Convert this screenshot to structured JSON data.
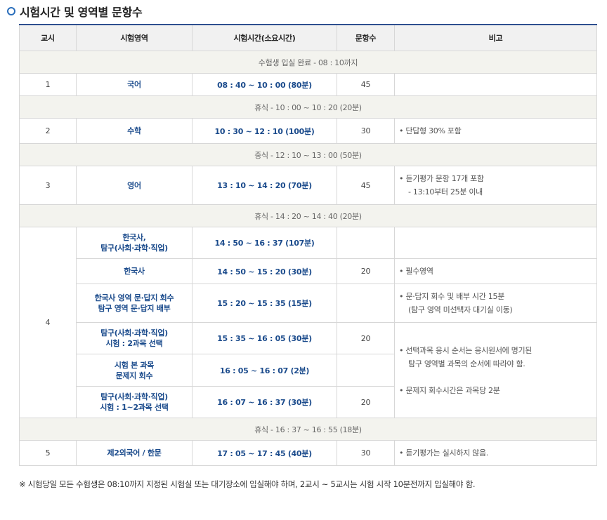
{
  "title": "시험시간 및 영역별 문항수",
  "headers": [
    "교시",
    "시험영역",
    "시험시간(소요시간)",
    "문항수",
    "비고"
  ],
  "rows": {
    "entry": "수험생 입실 완료 - 08 : 10까지",
    "p1": {
      "period": "1",
      "subject": "국어",
      "time": "08 : 40 ~ 10 : 00 (80분)",
      "count": "45",
      "note": ""
    },
    "break1": "휴식 - 10 : 00 ~ 10 : 20 (20분)",
    "p2": {
      "period": "2",
      "subject": "수학",
      "time": "10 : 30 ~ 12 : 10 (100분)",
      "count": "30",
      "note": "• 단답형 30% 포함"
    },
    "lunch": "중식 - 12 : 10 ~ 13 : 00 (50분)",
    "p3": {
      "period": "3",
      "subject": "영어",
      "time": "13 : 10 ~ 14 : 20 (70분)",
      "count": "45",
      "note1": "• 듣기평가 문항 17개 포함",
      "note2": "- 13:10부터 25분 이내"
    },
    "break2": "휴식 - 14 : 20 ~ 14 : 40 (20분)",
    "p4": {
      "period": "4",
      "r1": {
        "subject1": "한국사,",
        "subject2": "탐구(사회·과학·직업)",
        "time": "14 : 50 ~ 16 : 37 (107분)"
      },
      "r2": {
        "subject": "한국사",
        "time": "14 : 50 ~ 15 : 20 (30분)",
        "count": "20",
        "note": "• 필수영역"
      },
      "r3": {
        "subject1": "한국사 영역 문·답지 회수",
        "subject2": "탐구 영역 문·답지 배부",
        "time": "15 : 20 ~ 15 : 35 (15분)",
        "note1": "• 문·답지 회수 및 배부 시간 15분",
        "note2": "(탐구 영역 미선택자 대기실 이동)"
      },
      "r4": {
        "subject1": "탐구(사회·과학·직업)",
        "subject2": "시험 : 2과목 선택",
        "time": "15 : 35 ~ 16 : 05 (30분)",
        "count": "20"
      },
      "r5": {
        "subject1": "시험 본 과목",
        "subject2": "문제지 회수",
        "time": "16 : 05 ~ 16 : 07 (2분)"
      },
      "r6": {
        "subject1": "탐구(사회·과학·직업)",
        "subject2": "시험 : 1~2과목 선택",
        "time": "16 : 07 ~ 16 : 37 (30분)",
        "count": "20"
      },
      "note_a1": "• 선택과목 응시 순서는 응시원서에 명기된",
      "note_a2": "탐구 영역별 과목의 순서에 따라야 함.",
      "note_b": "• 문제지 회수시간은 과목당 2분"
    },
    "break3": "휴식 - 16 : 37 ~ 16 : 55 (18분)",
    "p5": {
      "period": "5",
      "subject": "제2외국어 / 한문",
      "time": "17 : 05 ~ 17 : 45 (40분)",
      "count": "30",
      "note": "• 듣기평가는 실시하지 않음."
    }
  },
  "footer": "※ 시험당일 모든 수험생은 08:10까지 지정된 시험실 또는 대기장소에 입실해야 하며, 2교시 ~ 5교시는 시험 시작 10분전까지 입실해야 함."
}
